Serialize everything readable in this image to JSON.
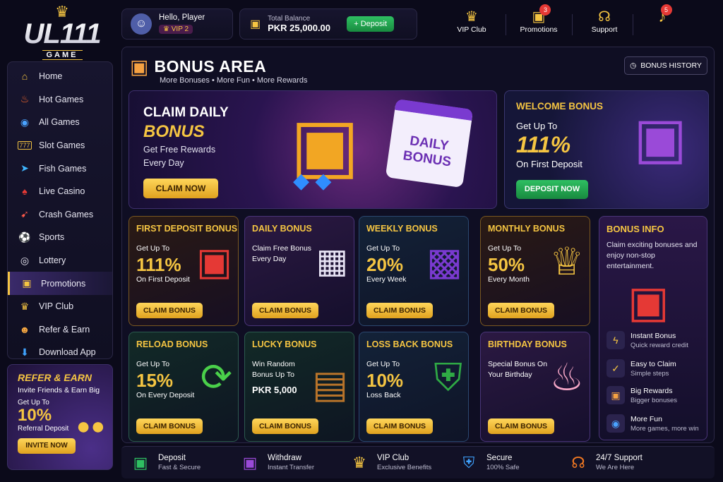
{
  "logo": {
    "brand": "UL111",
    "sub": "GAME"
  },
  "sidebar": {
    "items": [
      {
        "label": "Home",
        "icon": "home-icon",
        "glyph": "🏠"
      },
      {
        "label": "Hot Games",
        "icon": "fire-icon",
        "glyph": "🔥"
      },
      {
        "label": "All Games",
        "icon": "gamepad-icon",
        "glyph": "🎮"
      },
      {
        "label": "Slot Games",
        "icon": "slot-icon",
        "glyph": "🎰"
      },
      {
        "label": "Fish Games",
        "icon": "fish-icon",
        "glyph": "🐟"
      },
      {
        "label": "Live Casino",
        "icon": "cards-icon",
        "glyph": "🃏"
      },
      {
        "label": "Crash Games",
        "icon": "rocket-icon",
        "glyph": "🚀"
      },
      {
        "label": "Sports",
        "icon": "soccer-ball-icon",
        "glyph": "⚽"
      },
      {
        "label": "Lottery",
        "icon": "lottery-icon",
        "glyph": "🎱"
      },
      {
        "label": "Promotions",
        "icon": "gift-icon",
        "glyph": "🎁"
      },
      {
        "label": "VIP Club",
        "icon": "crown-icon",
        "glyph": "👑"
      },
      {
        "label": "Refer & Earn",
        "icon": "people-icon",
        "glyph": "👥"
      },
      {
        "label": "Download App",
        "icon": "download-icon",
        "glyph": "⬇"
      }
    ],
    "active": "Promotions"
  },
  "refer": {
    "title": "REFER & EARN",
    "subtitle": "Invite Friends & Earn Big",
    "get": "Get Up To",
    "percent": "10%",
    "desc": "Referral Deposit",
    "button": "INVITE NOW"
  },
  "user": {
    "greeting": "Hello, Player",
    "vip": "VIP 2"
  },
  "balance": {
    "label": "Total Balance",
    "amount": "PKR 25,000.00",
    "deposit": "+ Deposit"
  },
  "topnav": [
    {
      "label": "VIP Club",
      "badge": ""
    },
    {
      "label": "Promotions",
      "badge": "3"
    },
    {
      "label": "Support",
      "badge": ""
    }
  ],
  "notifications": {
    "badge": "5"
  },
  "bonus_area": {
    "title": "BONUS AREA",
    "subtitle": "More Bonuses • More Fun • More Rewards",
    "history": "BONUS HISTORY"
  },
  "daily": {
    "line1": "CLAIM DAILY",
    "line2": "BONUS",
    "desc": "Get Free Rewards Every Day",
    "button": "CLAIM NOW",
    "calendar": "DAILY BONUS"
  },
  "welcome": {
    "title": "WELCOME BONUS",
    "get": "Get Up To",
    "percent": "111%",
    "desc": "On First Deposit",
    "button": "DEPOSIT NOW"
  },
  "cards": [
    {
      "title": "FIRST DEPOSIT BONUS",
      "get": "Get Up To",
      "value": "111%",
      "desc": "On First Deposit",
      "button": "CLAIM BONUS"
    },
    {
      "title": "DAILY BONUS",
      "get": "Claim Free Bonus Every Day",
      "value": "",
      "desc": "",
      "button": "CLAIM BONUS"
    },
    {
      "title": "WEEKLY BONUS",
      "get": "Get Up To",
      "value": "20%",
      "desc": "Every Week",
      "button": "CLAIM BONUS"
    },
    {
      "title": "MONTHLY BONUS",
      "get": "Get Up To",
      "value": "50%",
      "desc": "Every Month",
      "button": "CLAIM BONUS"
    },
    {
      "title": "RELOAD BONUS",
      "get": "Get Up To",
      "value": "15%",
      "desc": "On Every Deposit",
      "button": "CLAIM BONUS"
    },
    {
      "title": "LUCKY BONUS",
      "get": "Win Random Bonus Up To",
      "value": "PKR 5,000",
      "desc": "",
      "button": "CLAIM BONUS"
    },
    {
      "title": "LOSS BACK BONUS",
      "get": "Get Up To",
      "value": "10%",
      "desc": "Loss Back",
      "button": "CLAIM BONUS"
    },
    {
      "title": "BIRTHDAY BONUS",
      "get": "Special Bonus On Your Birthday",
      "value": "",
      "desc": "",
      "button": "CLAIM BONUS"
    }
  ],
  "info": {
    "title": "BONUS INFO",
    "desc": "Claim exciting bonuses and enjoy non-stop entertainment.",
    "rows": [
      {
        "a": "Instant Bonus",
        "b": "Quick reward credit"
      },
      {
        "a": "Easy to Claim",
        "b": "Simple steps"
      },
      {
        "a": "Big Rewards",
        "b": "Bigger bonuses"
      },
      {
        "a": "More Fun",
        "b": "More games, more win"
      }
    ]
  },
  "footer": [
    {
      "a": "Deposit",
      "b": "Fast & Secure"
    },
    {
      "a": "Withdraw",
      "b": "Instant Transfer"
    },
    {
      "a": "VIP Club",
      "b": "Exclusive Benefits"
    },
    {
      "a": "Secure",
      "b": "100% Safe"
    },
    {
      "a": "24/7 Support",
      "b": "We Are Here"
    }
  ],
  "colors": {
    "accent": "#f5c542",
    "green": "#2fbf62",
    "bg": "#0b0a1a"
  }
}
